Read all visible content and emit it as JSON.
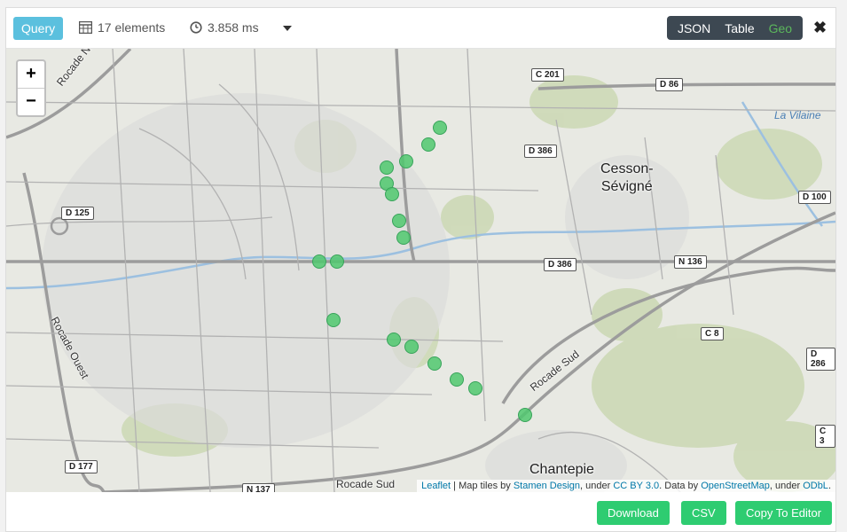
{
  "toolbar": {
    "query_label": "Query",
    "element_count": "17 elements",
    "timing": "3.858 ms",
    "views": [
      "JSON",
      "Table",
      "Geo"
    ],
    "active_view": "Geo",
    "icons": {
      "count": "table-grid-icon",
      "time": "clock-icon",
      "close": "close-icon",
      "dropdown": "caret-down-icon"
    }
  },
  "map": {
    "zoom_in": "+",
    "zoom_out": "−",
    "places": {
      "cesson_line1": "Cesson-",
      "cesson_line2": "Sévigné",
      "chantepie": "Chantepie"
    },
    "water": {
      "vilaine": "La Vilaine"
    },
    "streets": {
      "rocade_nord_ouest": "Rocade Nord-Ouest",
      "rocade_ouest": "Rocade Ouest",
      "rocade_sud_bottom": "Rocade Sud",
      "rocade_sud_right": "Rocade Sud"
    },
    "road_labels": {
      "c201": "C 201",
      "d86": "D 86",
      "d386a": "D 386",
      "d386b": "D 386",
      "d100": "D 100",
      "d125": "D 125",
      "n136": "N 136",
      "c8": "C 8",
      "d286": "D 286",
      "c3": "C 3",
      "d177": "D 177",
      "n137": "N 137"
    },
    "marker_color": "#50c86e",
    "attribution": {
      "leaflet": "Leaflet",
      "sep1": " | Map tiles by ",
      "stamen": "Stamen Design",
      "sep2": ", under ",
      "ccby": "CC BY 3.0",
      "sep3": ". Data by ",
      "osm": "OpenStreetMap",
      "sep4": ", under ",
      "odbl": "ODbL",
      "end": "."
    }
  },
  "footer": {
    "download": "Download",
    "csv": "CSV",
    "copy": "Copy To Editor"
  }
}
